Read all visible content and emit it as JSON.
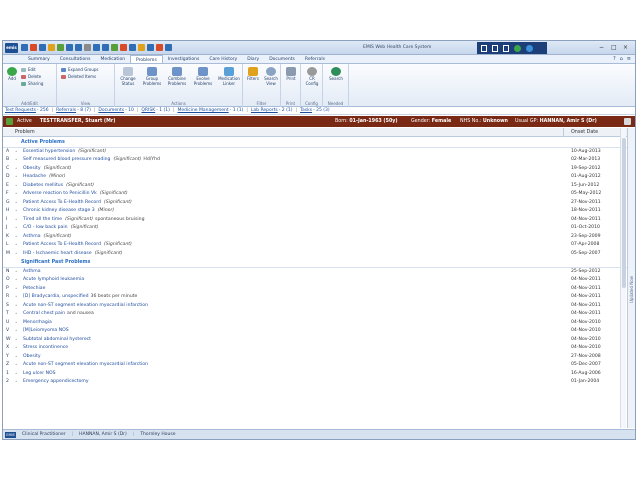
{
  "app": {
    "title": "EMIS Web Health Care System",
    "logo": "emis",
    "quick_access_icons": [
      "#2f6db5",
      "#d94a2a",
      "#2f6db5",
      "#e0a21b",
      "#5a9e3a",
      "#2f6db5",
      "#2f6db5",
      "#8a8a8a",
      "#2f6db5",
      "#2f6db5",
      "#5a9e3a",
      "#d94a2a",
      "#2f6db5",
      "#e0a21b",
      "#2f6db5",
      "#d94a2a",
      "#2f6db5"
    ],
    "title_right_icons": [
      "square-icon",
      "document-icon",
      "folder-icon",
      "green-circle-icon",
      "blue-circle-icon"
    ],
    "window_controls": [
      "−",
      "□",
      "×"
    ]
  },
  "menu": {
    "tabs": [
      "Summary",
      "Consultations",
      "Medication",
      "Problems",
      "Investigations",
      "Care History",
      "Diary",
      "Documents",
      "Referrals"
    ],
    "active_tab": "Problems",
    "right_icons": [
      "?",
      "⌂",
      "≡"
    ]
  },
  "ribbon": {
    "add": "Add",
    "edit": "Edit",
    "delete": "Delete",
    "sharing": "Sharing",
    "expand_groups": "Expand Groups",
    "deleted_items": "Deleted Items",
    "change_status": "Change Status",
    "group_problems": "Group Problems",
    "combine_problems": "Combine Problems",
    "evolve_problems": "Evolve Problems",
    "medication_linker": "Medication Linker",
    "filters": "Filters",
    "search_view": "Search View",
    "print": "Print",
    "cr_config": "CR Config",
    "search": "Search",
    "group_labels": {
      "add_edit": "Add/Edit",
      "view": "View",
      "actions": "Actions",
      "filter": "Filter",
      "print": "Print",
      "config": "Config",
      "needed": "Needed"
    }
  },
  "counts": [
    {
      "label": "Test Requests",
      "value": "- 256"
    },
    {
      "label": "Referrals",
      "value": "- 8 (7)"
    },
    {
      "label": "Documents",
      "value": "- 10"
    },
    {
      "label": "QRISK",
      "value": "- 1 (1)"
    },
    {
      "label": "Medicine Management",
      "value": "- 1 (1)"
    },
    {
      "label": "Lab Reports",
      "value": "- 2 (1)"
    },
    {
      "label": "Tasks",
      "value": "- 25 (3)"
    }
  ],
  "patient": {
    "status": "Active",
    "name": "TESTTRANSFER, Stuart (Mr)",
    "born_label": "Born:",
    "born": "01-Jan-1963 (50y)",
    "gender_label": "Gender:",
    "gender": "Female",
    "nhs_label": "NHS No.:",
    "nhs": "Unknown",
    "gp_label": "Usual GP:",
    "gp": "HANNAN, Amir S (Dr)"
  },
  "grid": {
    "col_problem": "Problem",
    "col_onset": "Onset Date",
    "active_heading": "Active Problems",
    "past_heading": "Significant Past Problems",
    "active": [
      {
        "letter": "A",
        "name": "Essential hypertension",
        "detail": "(Significant)",
        "extra": "",
        "date": "10-Aug-2013"
      },
      {
        "letter": "B",
        "name": "Self measured blood pressure reading",
        "detail": "(Significant)",
        "extra": "Hd/Yhd",
        "date": "02-Mar-2013"
      },
      {
        "letter": "C",
        "name": "Obesity",
        "detail": "(Significant)",
        "extra": "",
        "date": "19-Sep-2012"
      },
      {
        "letter": "D",
        "name": "Headache",
        "detail": "(Minor)",
        "extra": "",
        "date": "01-Aug-2012"
      },
      {
        "letter": "E",
        "name": "Diabetes mellitus",
        "detail": "(Significant)",
        "extra": "",
        "date": "15-Jun-2012"
      },
      {
        "letter": "F",
        "name": "Adverse reaction to Penicillin Vk",
        "detail": "(Significant)",
        "extra": "",
        "date": "05-May-2012"
      },
      {
        "letter": "G",
        "name": "Patient Access To E-Health Record",
        "detail": "(Significant)",
        "extra": "",
        "date": "27-Nov-2011"
      },
      {
        "letter": "H",
        "name": "Chronic kidney disease stage 3",
        "detail": "(Minor)",
        "extra": "",
        "date": "18-Nov-2011"
      },
      {
        "letter": "I",
        "name": "Tired all the time",
        "detail": "(Significant)",
        "extra": "spontaneous bruising",
        "date": "04-Nov-2011"
      },
      {
        "letter": "J",
        "name": "C/O - low back pain",
        "detail": "(Significant)",
        "extra": "",
        "date": "01-Oct-2010"
      },
      {
        "letter": "K",
        "name": "Asthma",
        "detail": "(Significant)",
        "extra": "",
        "date": "23-Sep-2009"
      },
      {
        "letter": "L",
        "name": "Patient Access To E-Health Record",
        "detail": "(Significant)",
        "extra": "",
        "date": "07-Apr-2008"
      },
      {
        "letter": "M",
        "name": "IHD - Ischaemic heart disease",
        "detail": "(Significant)",
        "extra": "",
        "date": "05-Sep-2007"
      }
    ],
    "past": [
      {
        "letter": "N",
        "name": "Asthma",
        "detail": "",
        "extra": "",
        "date": "25-Sep-2012"
      },
      {
        "letter": "O",
        "name": "Acute lymphoid leukaemia",
        "detail": "",
        "extra": "",
        "date": "04-Nov-2011"
      },
      {
        "letter": "P",
        "name": "Petechiae",
        "detail": "",
        "extra": "",
        "date": "04-Nov-2011"
      },
      {
        "letter": "R",
        "name": "[D] Bradycardia, unspecified",
        "detail": "",
        "extra": "36 beats per minute",
        "date": "04-Nov-2011"
      },
      {
        "letter": "S",
        "name": "Acute non-ST segment elevation myocardial infarction",
        "detail": "",
        "extra": "",
        "date": "04-Nov-2011"
      },
      {
        "letter": "T",
        "name": "Central chest pain",
        "detail": "",
        "extra": "and nausea",
        "date": "04-Nov-2011"
      },
      {
        "letter": "U",
        "name": "Menorrhagia",
        "detail": "",
        "extra": "",
        "date": "04-Nov-2010"
      },
      {
        "letter": "V",
        "name": "[M]Leiomyoma NOS",
        "detail": "",
        "extra": "",
        "date": "04-Nov-2010"
      },
      {
        "letter": "W",
        "name": "Subtotal abdominal hysterect",
        "detail": "",
        "extra": "",
        "date": "04-Nov-2010"
      },
      {
        "letter": "X",
        "name": "Stress incontinence",
        "detail": "",
        "extra": "",
        "date": "04-Nov-2010"
      },
      {
        "letter": "Y",
        "name": "Obesity",
        "detail": "",
        "extra": "",
        "date": "27-Nov-2008"
      },
      {
        "letter": "Z",
        "name": "Acute non-ST segment elevation myocardial infarction",
        "detail": "",
        "extra": "",
        "date": "05-Dec-2007"
      },
      {
        "letter": "1",
        "name": "Leg ulcer NOS",
        "detail": "",
        "extra": "",
        "date": "16-Aug-2006"
      },
      {
        "letter": "2",
        "name": "Emergency appendicectomy",
        "detail": "",
        "extra": "",
        "date": "01-Jan-2004"
      }
    ]
  },
  "side_tab": "Updated Now",
  "status": {
    "logo": "EMIS",
    "role": "Clinical Practitioner",
    "user": "HANNAN, Amir S (Dr)",
    "location": "Thornley House"
  },
  "colors": {
    "banner": "#7a2a14",
    "accent": "#1c4a9c",
    "section": "#2a6fc4"
  }
}
